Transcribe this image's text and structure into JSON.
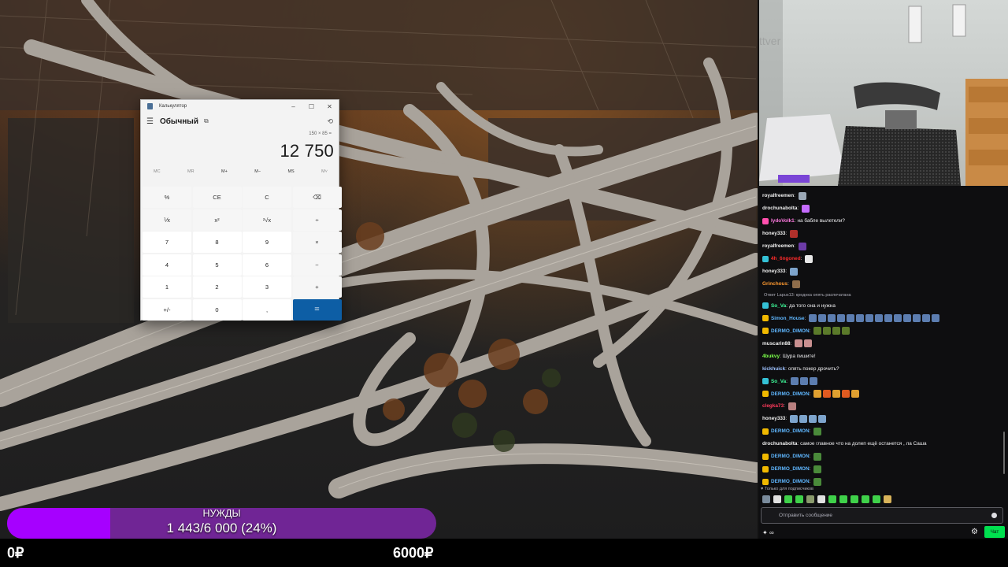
{
  "calculator": {
    "title": "Калькулятор",
    "mode": "Обычный",
    "expression": "150 × 85 =",
    "result": "12 750",
    "memory": [
      "MC",
      "MR",
      "M+",
      "M−",
      "MS",
      "M˅"
    ],
    "keys": [
      "%",
      "CE",
      "C",
      "⌫",
      "⅟x",
      "x²",
      "²√x",
      "÷",
      "7",
      "8",
      "9",
      "×",
      "4",
      "5",
      "6",
      "−",
      "1",
      "2",
      "3",
      "+",
      "+/-",
      "0",
      ",",
      "="
    ]
  },
  "webcam": {
    "watermark": "ttver"
  },
  "chat": {
    "messages": [
      {
        "user": "royalfreemen",
        "color": "#f0f0f0",
        "text": "",
        "badge": "",
        "emotes": [
          "#9aa7b5"
        ]
      },
      {
        "user": "drochunabolta",
        "color": "#f0f0f0",
        "text": "",
        "badge": "",
        "emotes": [
          "#c56bff"
        ]
      },
      {
        "user": "lydoVolk1",
        "color": "#ff7ae0",
        "text": "на бабле вылетели?",
        "badge": "#ff4fae",
        "emotes": []
      },
      {
        "user": "honey333",
        "color": "#f0f0f0",
        "text": "",
        "badge": "",
        "emotes": [
          "#b0302b"
        ]
      },
      {
        "user": "royalfreemen",
        "color": "#f0f0f0",
        "text": "",
        "badge": "",
        "emotes": [
          "#6c3ba6"
        ]
      },
      {
        "user": "4h_6ngoned",
        "color": "#ff2b2b",
        "text": "",
        "badge": "#34c1d6",
        "emotes": [
          "#e8e8e8"
        ]
      },
      {
        "user": "honey333",
        "color": "#f0f0f0",
        "text": "",
        "badge": "",
        "emotes": [
          "#7da4cc"
        ]
      },
      {
        "user": "Grinchous",
        "color": "#ff9a30",
        "text": "",
        "badge": "",
        "emotes": [
          "#8f6d4b"
        ]
      },
      {
        "user": "So_Va",
        "color": "#3fff9c",
        "text": "да того она и нужна",
        "badge": "#34c1d6",
        "emotes": []
      },
      {
        "user": "Simon_House",
        "color": "#5fb7ff",
        "text": "",
        "badge": "#f0b800",
        "emotes": [
          "#5c7db0",
          "#5c7db0",
          "#5c7db0",
          "#5c7db0",
          "#5c7db0",
          "#5c7db0",
          "#5c7db0",
          "#5c7db0",
          "#5c7db0",
          "#5c7db0",
          "#5c7db0",
          "#5c7db0",
          "#5c7db0",
          "#5c7db0"
        ]
      },
      {
        "user": "DERMO_DIMON",
        "color": "#5fb7ff",
        "text": "",
        "badge": "#f0b800",
        "emotes": [
          "#5b7a2a",
          "#5b7a2a",
          "#5b7a2a",
          "#5b7a2a"
        ]
      },
      {
        "user": "muscarin88",
        "color": "#f0f0f0",
        "text": "",
        "badge": "",
        "emotes": [
          "#c99090",
          "#c99090"
        ]
      },
      {
        "user": "4bukvy",
        "color": "#7bff4a",
        "text": "Шура пишите!",
        "badge": "",
        "emotes": []
      },
      {
        "user": "kickhuick",
        "color": "#9ec2ff",
        "text": "опять покер дрочить?",
        "badge": "",
        "emotes": []
      },
      {
        "user": "So_Va",
        "color": "#3fff9c",
        "text": "",
        "badge": "#34c1d6",
        "emotes": [
          "#5c7db0",
          "#5c7db0",
          "#5c7db0"
        ]
      },
      {
        "user": "DERMO_DIMON",
        "color": "#5fb7ff",
        "text": "",
        "badge": "#f0b800",
        "emotes": [
          "#e0a030",
          "#e05a20",
          "#e0a030",
          "#e05a20",
          "#e0a030"
        ]
      },
      {
        "user": "clegka73",
        "color": "#ff3b5c",
        "text": "",
        "badge": "",
        "emotes": [
          "#b88080"
        ]
      },
      {
        "user": "honey333",
        "color": "#f0f0f0",
        "text": "",
        "badge": "",
        "emotes": [
          "#7da4cc",
          "#7da4cc",
          "#7da4cc",
          "#7da4cc"
        ]
      },
      {
        "user": "DERMO_DIMON",
        "color": "#5fb7ff",
        "text": "",
        "badge": "#f0b800",
        "emotes": [
          "#4a8a3a"
        ]
      },
      {
        "user": "drochunabolta",
        "color": "#f0f0f0",
        "text": "самое главное что на долеп ещё останется , ла Саша",
        "badge": "",
        "emotes": []
      },
      {
        "user": "DERMO_DIMON",
        "color": "#5fb7ff",
        "text": "",
        "badge": "#f0b800",
        "emotes": [
          "#4a8a3a"
        ]
      },
      {
        "user": "DERMO_DIMON",
        "color": "#5fb7ff",
        "text": "",
        "badge": "#f0b800",
        "emotes": [
          "#4a8a3a"
        ]
      },
      {
        "user": "DERMO_DIMON",
        "color": "#5fb7ff",
        "text": "",
        "badge": "#f0b800",
        "emotes": [
          "#4a8a3a"
        ]
      }
    ],
    "reply_context": "Ответ Lapus13: креднка опять распечатана",
    "subs_only_label": "Только для подписчиков",
    "input_placeholder": "Отправить сообщение",
    "points_label": "∞",
    "chat_button": "Чат"
  },
  "goal": {
    "title": "НУЖДЫ",
    "amount": "1 443/6 000 (24%)",
    "progress": 0.24,
    "min_label": "0₽",
    "max_label": "6000₽"
  }
}
